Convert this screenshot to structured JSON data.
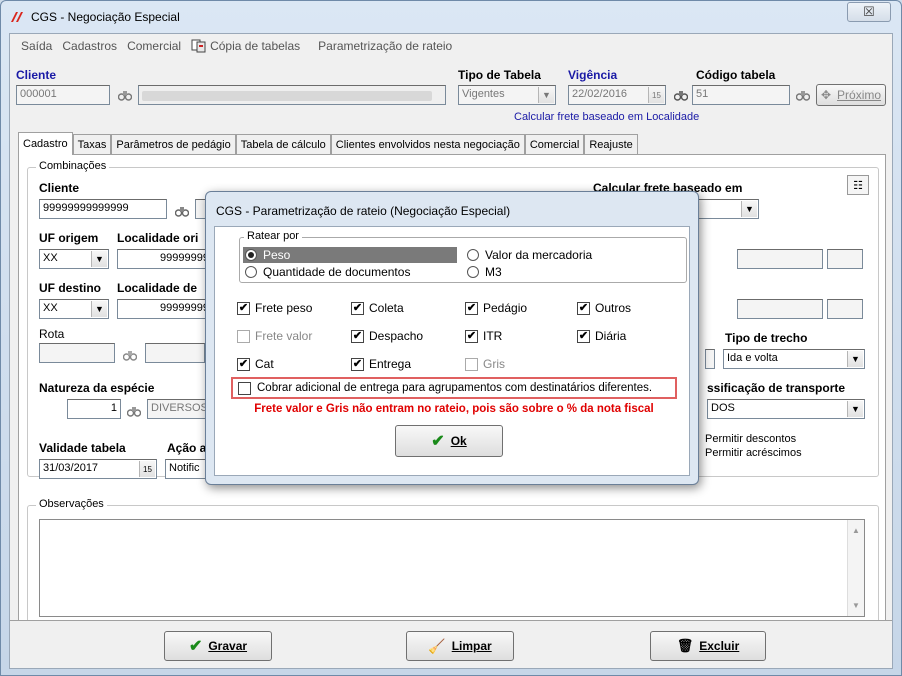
{
  "window": {
    "title": "CGS - Negociação Especial",
    "close_symbol": "☒"
  },
  "menu": {
    "items": [
      "Saída",
      "Cadastros",
      "Comercial",
      "Cópia de tabelas",
      "Parametrização de rateio"
    ]
  },
  "header": {
    "cliente_label": "Cliente",
    "cliente_code": "000001",
    "tipo_tabela_label": "Tipo de Tabela",
    "tipo_tabela_value": "Vigentes",
    "vigencia_label": "Vigência",
    "vigencia_value": "22/02/2016",
    "codigo_tabela_label": "Código tabela",
    "codigo_tabela_value": "51",
    "proximo_label": "Próximo",
    "calc_note": "Calcular frete baseado em Localidade"
  },
  "tabs": [
    "Cadastro",
    "Taxas",
    "Parâmetros de pedágio",
    "Tabela de cálculo",
    "Clientes envolvidos nesta negociação",
    "Comercial",
    "Reajuste"
  ],
  "form": {
    "combinacoes_title": "Combinações",
    "cliente_label": "Cliente",
    "cliente_value": "99999999999999",
    "calc_frete_label": "Calcular frete baseado em",
    "uf_origem_label": "UF origem",
    "uf_origem_value": "XX",
    "localidade_origem_label": "Localidade ori",
    "localidade_origem_value": "99999999",
    "uf_destino_label": "UF destino",
    "uf_destino_value": "XX",
    "localidade_destino_label": "Localidade de",
    "localidade_destino_value": "99999999",
    "rota_label": "Rota",
    "tipo_trecho_label": "Tipo de trecho",
    "tipo_trecho_value": "Ida e volta",
    "natureza_label": "Natureza da espécie",
    "natureza_code": "1",
    "natureza_value": "DIVERSOS",
    "class_transporte_label": "ssificação de transporte",
    "class_transporte_value": "DOS",
    "validade_label": "Validade tabela",
    "validade_value": "31/03/2017",
    "acao_label": "Ação a",
    "acao_value": "Notific",
    "permitir_descontos": "Permitir descontos",
    "permitir_acrescimos": "Permitir acréscimos",
    "observacoes_label": "Observações"
  },
  "footer": {
    "gravar": "Gravar",
    "limpar": "Limpar",
    "excluir": "Excluir"
  },
  "dialog": {
    "title": "CGS - Parametrização de rateio (Negociação Especial)",
    "ratear_por_label": "Ratear por",
    "options": {
      "peso": "Peso",
      "valor_mercadoria": "Valor da mercadoria",
      "quantidade_documentos": "Quantidade de documentos",
      "m3": "M3"
    },
    "checks": {
      "frete_peso": "Frete peso",
      "coleta": "Coleta",
      "pedagio": "Pedágio",
      "outros": "Outros",
      "frete_valor": "Frete valor",
      "despacho": "Despacho",
      "itr": "ITR",
      "diaria": "Diária",
      "cat": "Cat",
      "entrega": "Entrega",
      "gris": "Gris"
    },
    "cobrar_label": "Cobrar adicional de entrega para agrupamentos com destinatários diferentes.",
    "warning": "Frete valor e Gris não entram no rateio, pois são sobre o % da nota fiscal",
    "ok_label": "Ok",
    "check_mark": "✔"
  }
}
